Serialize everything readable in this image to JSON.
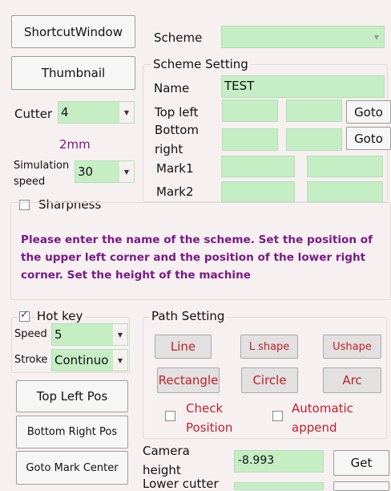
{
  "left": {
    "shortcut_window": "ShortcutWindow",
    "thumbnail": "Thumbnail",
    "cutter_label": "Cutter",
    "cutter_value": "4",
    "cutter_size": "2mm",
    "sim_label_1": "Simulation",
    "sim_label_2": "speed",
    "sim_value": "30",
    "sharpness": "Sharpness",
    "hotkey": "Hot key",
    "speed_label": "Speed",
    "speed_value": "5",
    "stroke_label": "Stroke",
    "stroke_value": "Continuo",
    "top_left_pos": "Top Left Pos",
    "bottom_right_pos": "Bottom Right Pos",
    "goto_mark_center": "Goto Mark Center"
  },
  "scheme": {
    "label": "Scheme",
    "value": "",
    "setting_title": "Scheme Setting",
    "name_label": "Name",
    "name_value": "TEST",
    "top_left_label": "Top left",
    "bottom_right_label_1": "Bottom",
    "bottom_right_label_2": "right",
    "mark1_label": "Mark1",
    "mark2_label": "Mark2",
    "goto_1": "Goto",
    "goto_2": "Goto"
  },
  "message": "Please enter the name of the scheme. Set the position of the upper left corner and the position of the lower right corner. Set the height of the machine",
  "path": {
    "title": "Path Setting",
    "line": "Line",
    "l_shape": "L shape",
    "u_shape": "Ushape",
    "rectangle": "Rectangle",
    "circle": "Circle",
    "arc": "Arc",
    "check_position_1": "Check",
    "check_position_2": "Position",
    "auto_append_1": "Automatic",
    "auto_append_2": "append"
  },
  "camera": {
    "label_1": "Camera",
    "label_2": "height",
    "value": "-8.993",
    "get": "Get",
    "lower_cutter": "Lower cutter"
  },
  "colors": {
    "background": "#f7f0f0",
    "field_green": "#c5eec5",
    "accent_purple": "#7a1a8a",
    "path_button_text": "#c0202a"
  },
  "state": {
    "hotkey_checked": true,
    "sharpness_checked": false,
    "check_position_checked": false,
    "auto_append_checked": false
  }
}
